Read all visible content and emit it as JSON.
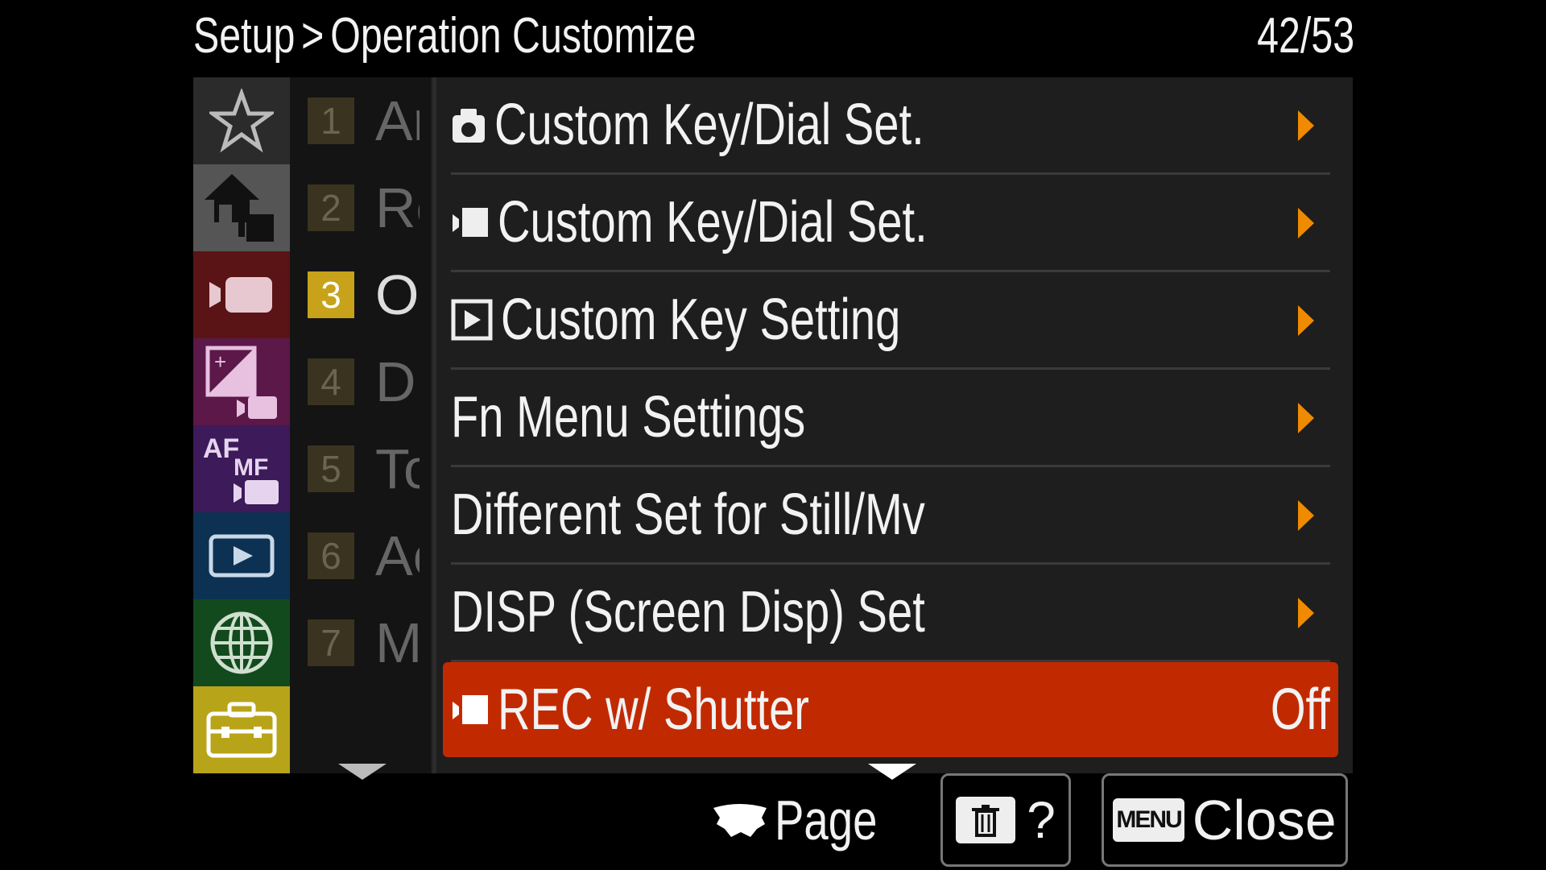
{
  "header": {
    "breadcrumb_root": "Setup",
    "breadcrumb_sep": ">",
    "breadcrumb_current": "Operation Customize",
    "page_counter": "42/53"
  },
  "categories": [
    {
      "name": "my-menu",
      "icon": "star-icon",
      "color": "#2b2b2b"
    },
    {
      "name": "main",
      "icon": "home-camera-icon",
      "color": "#555555"
    },
    {
      "name": "shooting",
      "icon": "movie-camera-icon",
      "color": "#5a1416"
    },
    {
      "name": "exposure",
      "icon": "exposure-icon",
      "color": "#5b1848"
    },
    {
      "name": "focus",
      "icon": "af-mf-icon",
      "color": "#3d1a5a",
      "icon_text_af": "AF",
      "icon_text_mf": "MF"
    },
    {
      "name": "playback",
      "icon": "playback-icon",
      "color": "#0d3152"
    },
    {
      "name": "network",
      "icon": "globe-icon",
      "color": "#124a1e"
    },
    {
      "name": "setup",
      "icon": "toolbox-icon",
      "color": "#b8a418"
    }
  ],
  "subcategories": [
    {
      "num": "1",
      "label": "Ar"
    },
    {
      "num": "2",
      "label": "Re"
    },
    {
      "num": "3",
      "label": "Op"
    },
    {
      "num": "4",
      "label": "Di"
    },
    {
      "num": "5",
      "label": "To"
    },
    {
      "num": "6",
      "label": "Ac"
    },
    {
      "num": "7",
      "label": "M"
    }
  ],
  "items": [
    {
      "label": "Custom Key/Dial Set.",
      "icon": "still-camera-icon"
    },
    {
      "label": "Custom Key/Dial Set.",
      "icon": "movie-icon"
    },
    {
      "label": "Custom Key Setting",
      "icon": "playback-box-icon"
    },
    {
      "label": "Fn Menu Settings"
    },
    {
      "label": "Different Set for Still/Mv"
    },
    {
      "label": "DISP (Screen Disp) Set"
    },
    {
      "label": "REC w/ Shutter",
      "icon": "movie-icon",
      "value": "Off"
    }
  ],
  "footer": {
    "page_label": "Page",
    "help_label": "?",
    "menu_key_label": "MENU",
    "close_label": "Close"
  },
  "colors": {
    "accent_orange": "#f08a00",
    "selected_red": "#c12a00",
    "active_sub_yellow": "#c7a21a"
  }
}
